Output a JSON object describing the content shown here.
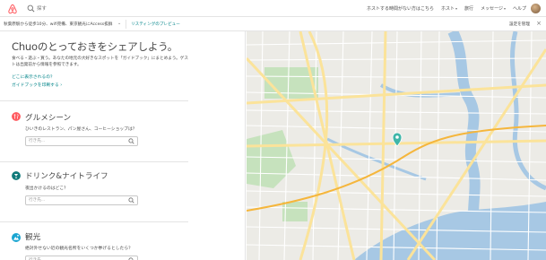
{
  "header": {
    "search_placeholder": "探す",
    "nav": {
      "host_tips": "ホストする時間がない方はこちら",
      "host": "ホスト",
      "trips": "旅行",
      "messages": "メッセージ",
      "help": "ヘルプ"
    }
  },
  "subbar": {
    "listing_name": "秋葉原駅から徒歩10分、wifi完備、東京観光にAccess抜群",
    "preview_link": "リスティングのプレビュー",
    "manage_settings": "設定を管理"
  },
  "guidebook": {
    "headline": "Chuoのとっておきをシェアしよう。",
    "intro": "食べる・遊ぶ・買う。あなたの地元の大好きなスポットを「ガイドブック」にまとめよう。ゲストは出発前から情報を参照できます。",
    "where_link": "どこに表示されるの？",
    "print_link": "ガイドブックを印刷する ›",
    "sections": [
      {
        "title": "グルメシーン",
        "subtitle": "ひいきのレストラン、パン屋さん、コーヒーショップは？",
        "placeholder": "行き先..."
      },
      {
        "title": "ドリンク&ナイトライフ",
        "subtitle": "夜出かけるのはどこ？",
        "placeholder": "行き先..."
      },
      {
        "title": "観光",
        "subtitle": "絶対外せない近の観光名所をいくつか挙げるとしたら？",
        "placeholder": "行き先..."
      }
    ]
  },
  "map": {
    "water_color": "#a7c8e4",
    "park_color": "#c6e2bd",
    "major_road_color": "#fbe39a",
    "pin_color": "#3fb6a8"
  },
  "colors": {
    "brand": "#ff5a5f",
    "link": "#008489",
    "food_icon": "#ff5a5f",
    "drink_icon": "#0f7a7a",
    "sights_icon": "#1ba5d1"
  }
}
